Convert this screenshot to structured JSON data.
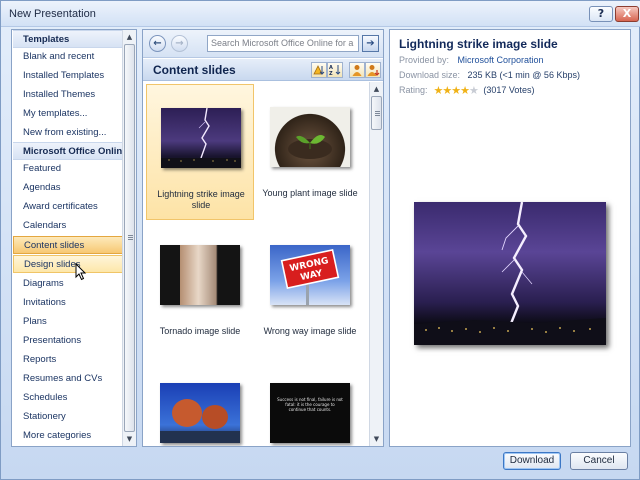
{
  "window": {
    "title": "New Presentation",
    "help_label": "?",
    "close_label": "X"
  },
  "left": {
    "items": [
      {
        "label": "Templates",
        "kind": "header"
      },
      {
        "label": "Blank and recent",
        "kind": "item"
      },
      {
        "label": "Installed Templates",
        "kind": "item"
      },
      {
        "label": "Installed Themes",
        "kind": "item"
      },
      {
        "label": "My templates...",
        "kind": "item"
      },
      {
        "label": "New from existing...",
        "kind": "item"
      },
      {
        "label": "Microsoft Office Online",
        "kind": "header"
      },
      {
        "label": "Featured",
        "kind": "item"
      },
      {
        "label": "Agendas",
        "kind": "item"
      },
      {
        "label": "Award certificates",
        "kind": "item"
      },
      {
        "label": "Calendars",
        "kind": "item"
      },
      {
        "label": "Content slides",
        "kind": "selected"
      },
      {
        "label": "Design slides",
        "kind": "hover"
      },
      {
        "label": "Diagrams",
        "kind": "item"
      },
      {
        "label": "Invitations",
        "kind": "item"
      },
      {
        "label": "Plans",
        "kind": "item"
      },
      {
        "label": "Presentations",
        "kind": "item"
      },
      {
        "label": "Reports",
        "kind": "item"
      },
      {
        "label": "Resumes and CVs",
        "kind": "item"
      },
      {
        "label": "Schedules",
        "kind": "item"
      },
      {
        "label": "Stationery",
        "kind": "item"
      },
      {
        "label": "More categories",
        "kind": "item"
      }
    ]
  },
  "middle": {
    "search_placeholder": "Search Microsoft Office Online for a",
    "section_title": "Content slides",
    "templates": [
      {
        "label": "Lightning strike image slide",
        "image": "lightning-image",
        "selected": true
      },
      {
        "label": "Young plant image slide",
        "image": "plant-image",
        "selected": false
      },
      {
        "label": "Tornado image slide",
        "image": "tornado-image",
        "selected": false
      },
      {
        "label": "Wrong way image slide",
        "image": "wrong-way-sign-image",
        "selected": false
      },
      {
        "label": "",
        "image": "rocks-image",
        "selected": false
      },
      {
        "label": "",
        "image": "quote-image",
        "selected": false
      }
    ],
    "wrong_way_text": [
      "WRONG",
      "WAY"
    ],
    "quote_text": "Success is not final, failure is not fatal: it is the courage to continue that counts."
  },
  "details": {
    "title": "Lightning strike image slide",
    "provided_by_label": "Provided by:",
    "provided_by_value": "Microsoft Corporation",
    "download_size_label": "Download size:",
    "download_size_value": "235 KB (<1 min @ 56 Kbps)",
    "rating_label": "Rating:",
    "rating_stars": 4,
    "rating_max": 5,
    "votes_text": "(3017 Votes)"
  },
  "footer": {
    "download_label": "Download",
    "cancel_label": "Cancel"
  }
}
